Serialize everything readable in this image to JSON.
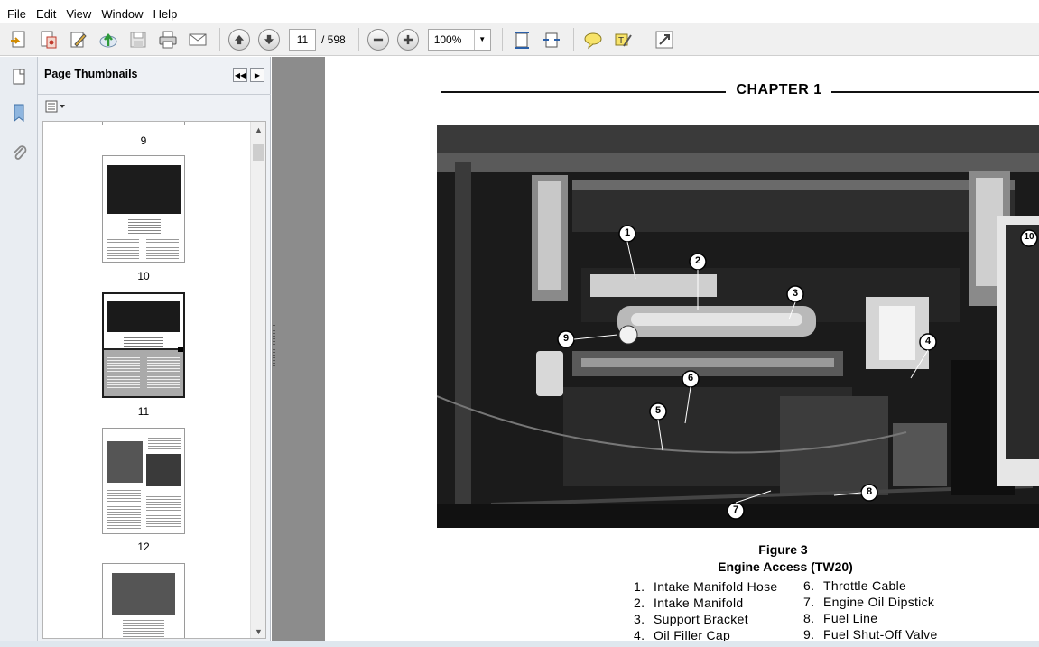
{
  "menu": [
    "File",
    "Edit",
    "View",
    "Window",
    "Help"
  ],
  "toolbar": {
    "icons": [
      "create-pdf-icon",
      "combine-files-icon",
      "edit-icon",
      "upload-cloud-icon",
      "save-icon",
      "print-icon",
      "email-icon",
      "previous-page-icon",
      "next-page-icon",
      "zoom-out-icon",
      "zoom-in-icon",
      "fit-page-icon",
      "fit-width-icon",
      "comment-icon",
      "highlight-icon",
      "full-screen-icon"
    ],
    "page_current": "11",
    "page_total": "/ 598",
    "zoom": "100%"
  },
  "panel": {
    "title": "Page Thumbnails",
    "thumbnails": [
      {
        "label": "9",
        "selected": false
      },
      {
        "label": "10",
        "selected": false
      },
      {
        "label": "11",
        "selected": true
      },
      {
        "label": "12",
        "selected": false
      }
    ]
  },
  "document": {
    "chapter": "CHAPTER 1",
    "figure_title": "Figure 3",
    "figure_subtitle": "Engine Access (TW20)",
    "callouts": [
      "1",
      "2",
      "3",
      "4",
      "5",
      "6",
      "7",
      "8",
      "9",
      "10"
    ],
    "legend_left": [
      {
        "num": "1.",
        "text": "Intake Manifold Hose"
      },
      {
        "num": "2.",
        "text": "Intake Manifold"
      },
      {
        "num": "3.",
        "text": "Support Bracket"
      },
      {
        "num": "4.",
        "text": "Oil Filler Cap"
      }
    ],
    "legend_right": [
      {
        "num": "6.",
        "text": "Throttle Cable"
      },
      {
        "num": "7.",
        "text": "Engine Oil Dipstick"
      },
      {
        "num": "8.",
        "text": "Fuel Line"
      },
      {
        "num": "9.",
        "text": "Fuel Shut-Off Valve"
      }
    ]
  }
}
